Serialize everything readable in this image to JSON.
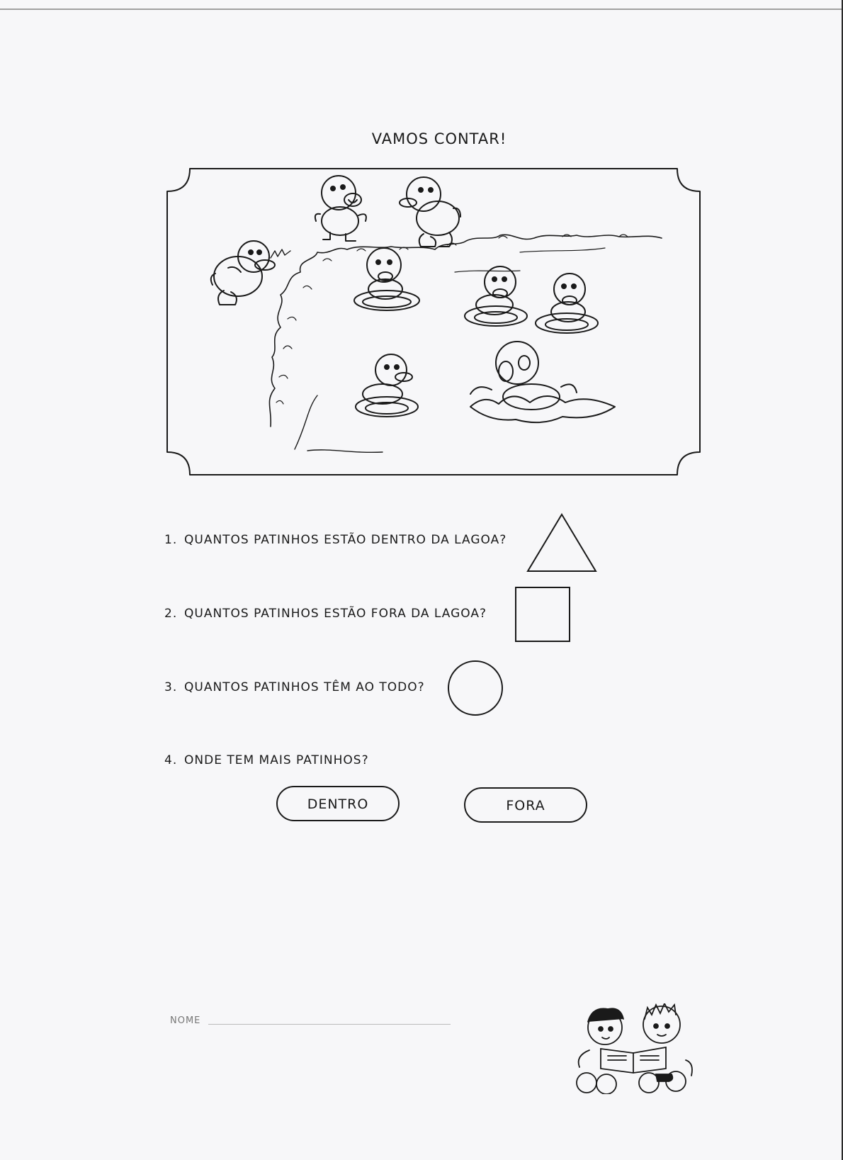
{
  "worksheet": {
    "title": "VAMOS CONTAR!",
    "questions": [
      {
        "number": "1.",
        "text": "QUANTOS PATINHOS ESTÃO DENTRO DA LAGOA?",
        "answer_shape": "triangle"
      },
      {
        "number": "2.",
        "text": "QUANTOS PATINHOS ESTÃO FORA DA LAGOA?",
        "answer_shape": "square"
      },
      {
        "number": "3.",
        "text": "QUANTOS PATINHOS TÊM AO TODO?",
        "answer_shape": "circle"
      },
      {
        "number": "4.",
        "text": "ONDE TEM MAIS PATINHOS?"
      }
    ],
    "options": [
      "DENTRO",
      "FORA"
    ],
    "name_label": "NOME"
  },
  "illustration": {
    "scene": "ducklings-pond-illustration",
    "ducklings_inside_pond": 5,
    "ducklings_outside_pond": 3
  }
}
